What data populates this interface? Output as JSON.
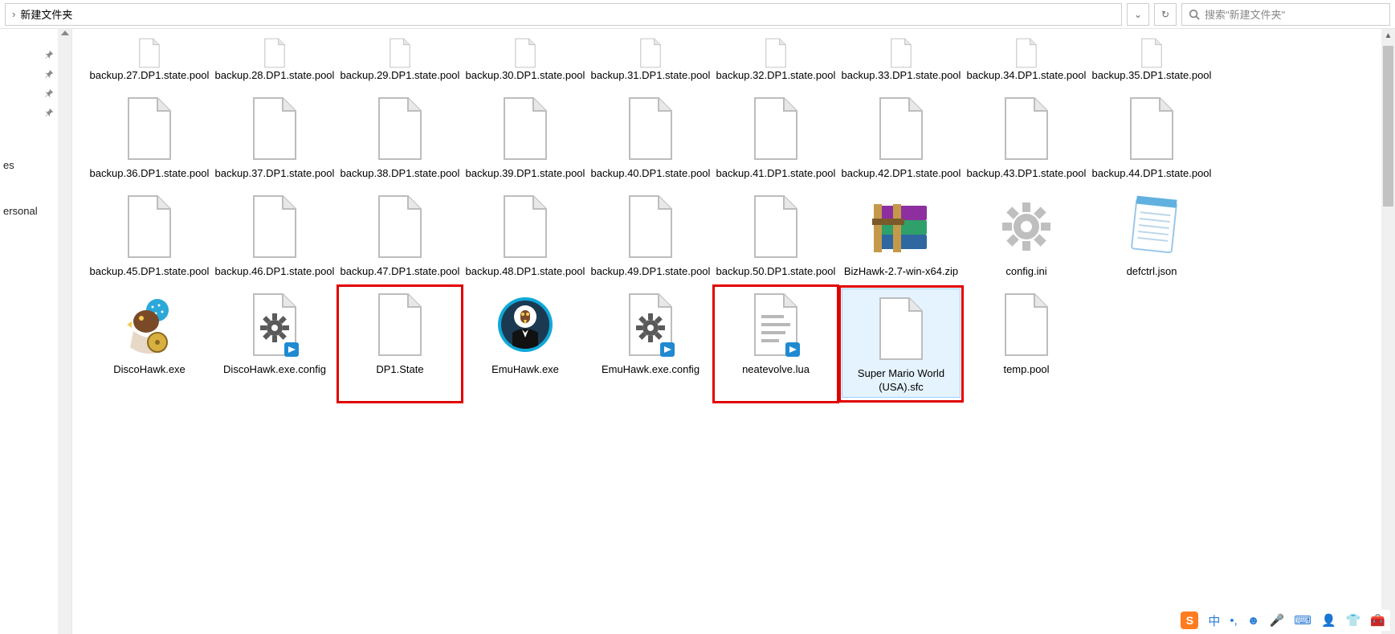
{
  "topbar": {
    "crumb_current": "新建文件夹",
    "search_placeholder": "搜索\"新建文件夹\""
  },
  "sidebar": {
    "text1": "es",
    "text2": "ersonal"
  },
  "files": [
    {
      "name": "backup.27.DP1.state.pool",
      "icon": "file",
      "short": true
    },
    {
      "name": "backup.28.DP1.state.pool",
      "icon": "file",
      "short": true
    },
    {
      "name": "backup.29.DP1.state.pool",
      "icon": "file",
      "short": true
    },
    {
      "name": "backup.30.DP1.state.pool",
      "icon": "file",
      "short": true
    },
    {
      "name": "backup.31.DP1.state.pool",
      "icon": "file",
      "short": true
    },
    {
      "name": "backup.32.DP1.state.pool",
      "icon": "file",
      "short": true
    },
    {
      "name": "backup.33.DP1.state.pool",
      "icon": "file",
      "short": true
    },
    {
      "name": "backup.34.DP1.state.pool",
      "icon": "file",
      "short": true
    },
    {
      "name": "backup.35.DP1.state.pool",
      "icon": "file",
      "short": true
    },
    {
      "name": "backup.36.DP1.state.pool",
      "icon": "file"
    },
    {
      "name": "backup.37.DP1.state.pool",
      "icon": "file"
    },
    {
      "name": "backup.38.DP1.state.pool",
      "icon": "file"
    },
    {
      "name": "backup.39.DP1.state.pool",
      "icon": "file"
    },
    {
      "name": "backup.40.DP1.state.pool",
      "icon": "file"
    },
    {
      "name": "backup.41.DP1.state.pool",
      "icon": "file"
    },
    {
      "name": "backup.42.DP1.state.pool",
      "icon": "file"
    },
    {
      "name": "backup.43.DP1.state.pool",
      "icon": "file"
    },
    {
      "name": "backup.44.DP1.state.pool",
      "icon": "file"
    },
    {
      "name": "backup.45.DP1.state.pool",
      "icon": "file"
    },
    {
      "name": "backup.46.DP1.state.pool",
      "icon": "file"
    },
    {
      "name": "backup.47.DP1.state.pool",
      "icon": "file"
    },
    {
      "name": "backup.48.DP1.state.pool",
      "icon": "file"
    },
    {
      "name": "backup.49.DP1.state.pool",
      "icon": "file"
    },
    {
      "name": "backup.50.DP1.state.pool",
      "icon": "file"
    },
    {
      "name": "BizHawk-2.7-win-x64.zip",
      "icon": "winrar"
    },
    {
      "name": "config.ini",
      "icon": "gear"
    },
    {
      "name": "defctrl.json",
      "icon": "notepad"
    },
    {
      "name": "DiscoHawk.exe",
      "icon": "discohawk"
    },
    {
      "name": "DiscoHawk.exe.config",
      "icon": "vsconfig"
    },
    {
      "name": "DP1.State",
      "icon": "file",
      "red": true
    },
    {
      "name": "EmuHawk.exe",
      "icon": "emuhawk"
    },
    {
      "name": "EmuHawk.exe.config",
      "icon": "vsconfig"
    },
    {
      "name": "neatevolve.lua",
      "icon": "luadoc",
      "red": true
    },
    {
      "name": "Super Mario World (USA).sfc",
      "icon": "file",
      "red": true,
      "selected": true
    },
    {
      "name": "temp.pool",
      "icon": "file"
    }
  ],
  "ime": {
    "lang": "中"
  }
}
